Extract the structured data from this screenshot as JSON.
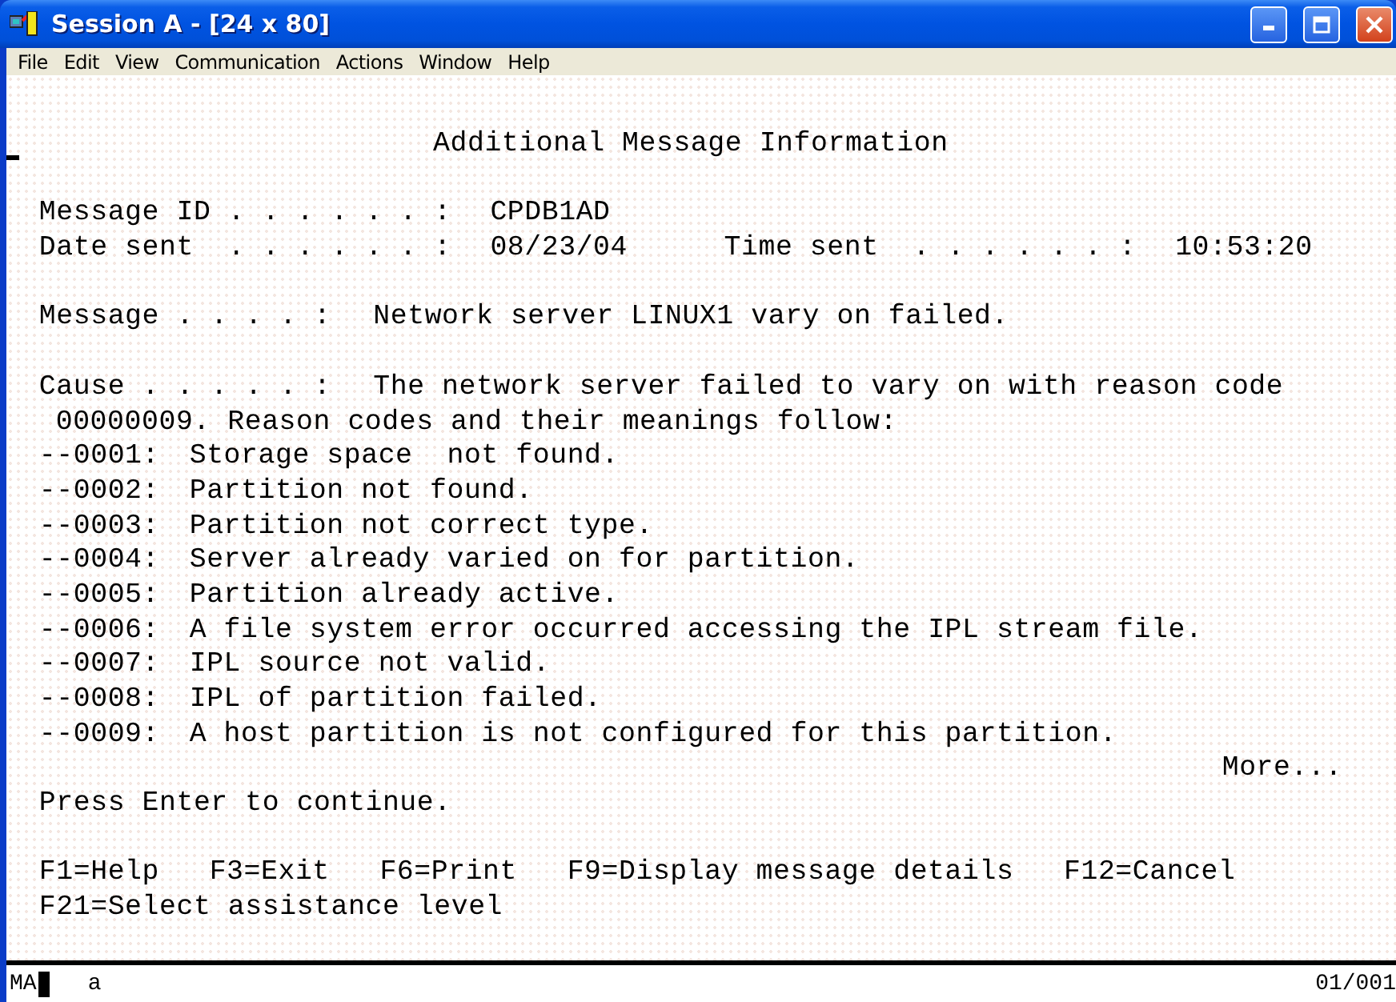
{
  "window": {
    "title": "Session A - [24 x 80]"
  },
  "menu": [
    "File",
    "Edit",
    "View",
    "Communication",
    "Actions",
    "Window",
    "Help"
  ],
  "screen": {
    "heading": "Additional Message Information",
    "fields": [
      [
        {
          "label": "Message ID . . . . . . :",
          "value": "CPDB1AD"
        }
      ],
      [
        {
          "label": "Date sent  . . . . . . :",
          "value": "08/23/04"
        },
        {
          "label": "Time sent  . . . . . . :",
          "value": "10:53:20"
        }
      ]
    ],
    "message": {
      "label": "Message . . . . :",
      "value": "Network server LINUX1 vary on failed."
    },
    "cause": {
      "label": "Cause . . . . . :",
      "value": "The network server failed to vary on with reason code",
      "continuation": "00000009. Reason codes and their meanings follow:"
    },
    "codes": [
      {
        "code": "--0001:",
        "text": "Storage space  not found."
      },
      {
        "code": "--0002:",
        "text": "Partition not found."
      },
      {
        "code": "--0003:",
        "text": "Partition not correct type."
      },
      {
        "code": "--0004:",
        "text": "Server already varied on for partition."
      },
      {
        "code": "--0005:",
        "text": "Partition already active."
      },
      {
        "code": "--0006:",
        "text": "A file system error occurred accessing the IPL stream file."
      },
      {
        "code": "--0007:",
        "text": "IPL source not valid."
      },
      {
        "code": "--0008:",
        "text": "IPL of partition failed."
      },
      {
        "code": "--0009:",
        "text": "A host partition is not configured for this partition."
      }
    ],
    "more": "More...",
    "prompt": "Press Enter to continue.",
    "function_keys": [
      [
        "F1=Help",
        "F3=Exit",
        "F6=Print",
        "F9=Display message details",
        "F12=Cancel"
      ],
      [
        "F21=Select assistance level"
      ]
    ]
  },
  "status_bar": {
    "mode": "MA",
    "input": "a",
    "position": "01/001"
  }
}
